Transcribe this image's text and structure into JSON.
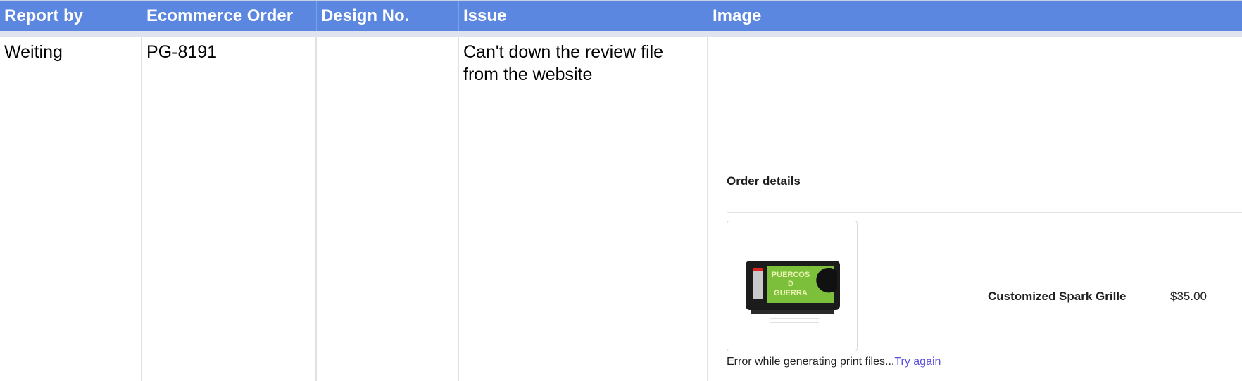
{
  "headers": [
    "Report by",
    "Ecommerce Order",
    "Design No.",
    "Issue",
    "Image"
  ],
  "row": {
    "report_by": "Weiting",
    "ecommerce_order": "PG-8191",
    "design_no": "",
    "issue_line1": "Can't down the review file",
    "issue_line2": "from the website"
  },
  "image": {
    "title": "Order details",
    "product_name": "Customized Spark Grille",
    "product_price": "$35.00",
    "error_text": "Error while generating print files...",
    "retry_link": "Try again",
    "thumb_logo_line1": "PUERCOS",
    "thumb_logo_line2": "D",
    "thumb_logo_line3": "GUERRA"
  }
}
